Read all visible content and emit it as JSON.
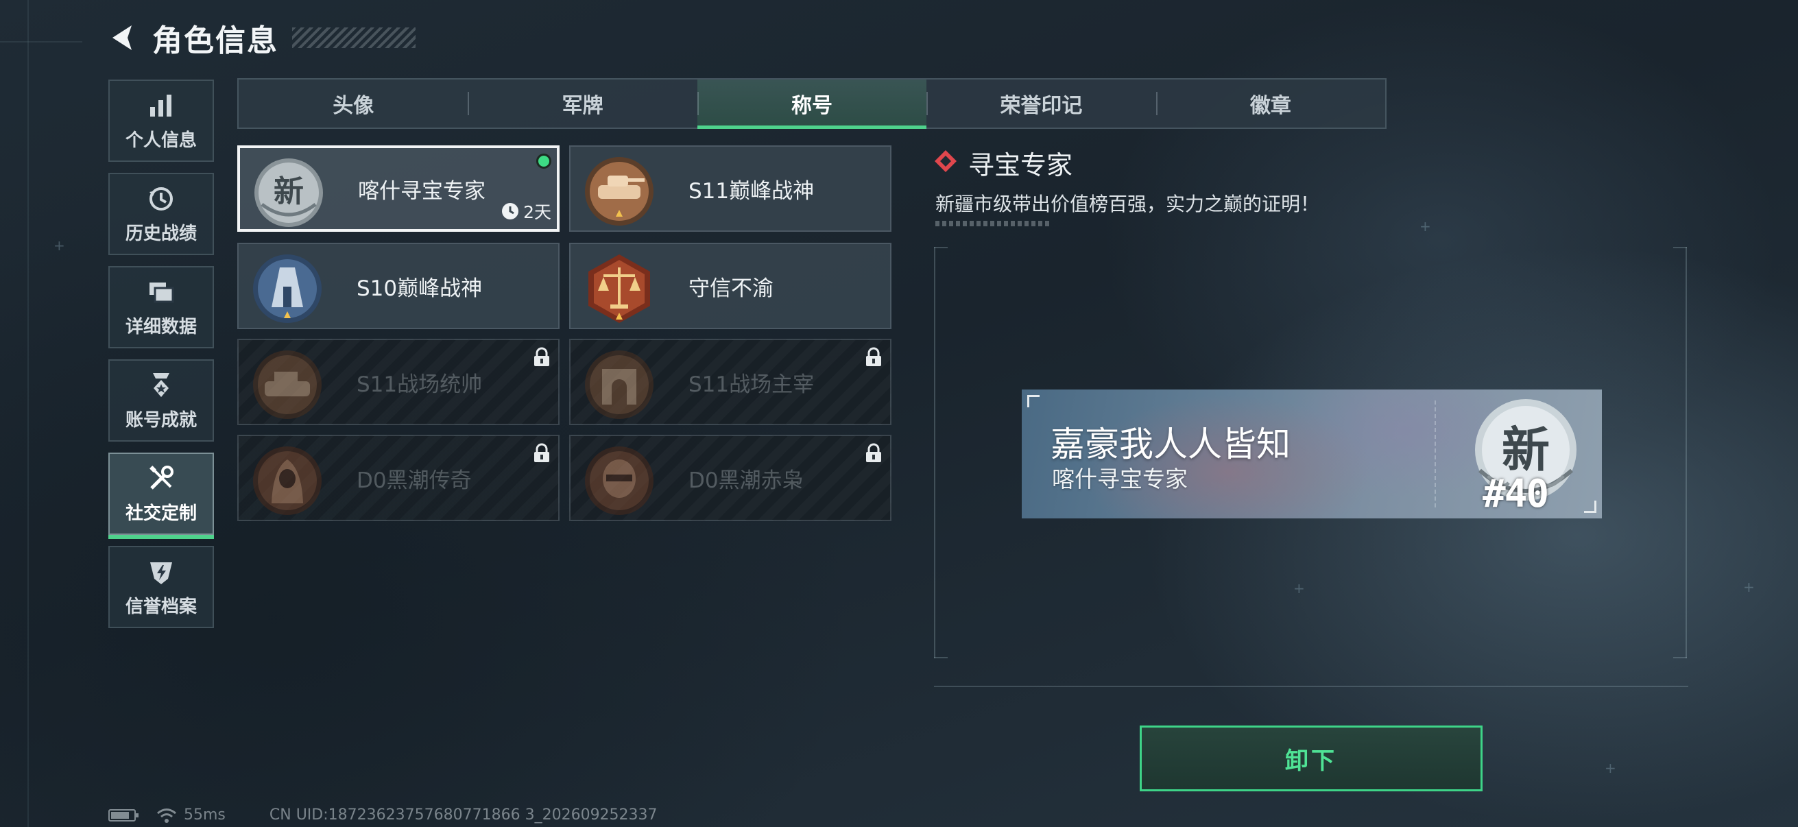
{
  "header": {
    "title": "角色信息"
  },
  "sidenav": [
    {
      "label": "个人信息",
      "icon": "bar-chart-icon",
      "active": false
    },
    {
      "label": "历史战绩",
      "icon": "history-clock-icon",
      "active": false
    },
    {
      "label": "详细数据",
      "icon": "folder-icon",
      "active": false
    },
    {
      "label": "账号成就",
      "icon": "achievement-medal-icon",
      "active": false
    },
    {
      "label": "社交定制",
      "icon": "tools-wrench-icon",
      "active": true
    },
    {
      "label": "信誉档案",
      "icon": "reputation-shield-icon",
      "active": false
    }
  ],
  "tabs": [
    {
      "label": "头像",
      "active": false
    },
    {
      "label": "军牌",
      "active": false
    },
    {
      "label": "称号",
      "active": true
    },
    {
      "label": "荣誉印记",
      "active": false
    },
    {
      "label": "徽章",
      "active": false
    }
  ],
  "titles": [
    {
      "label": "喀什寻宝专家",
      "emblem": "xin-emblem-icon",
      "state": "selected",
      "equipped": true,
      "timer": "2天"
    },
    {
      "label": "S11巅峰战神",
      "emblem": "tank-emblem-icon",
      "state": "unlocked"
    },
    {
      "label": "S10巅峰战神",
      "emblem": "tower-emblem-icon",
      "state": "unlocked"
    },
    {
      "label": "守信不渝",
      "emblem": "scales-emblem-icon",
      "state": "unlocked"
    },
    {
      "label": "S11战场统帅",
      "emblem": "vehicle-emblem-icon",
      "state": "locked"
    },
    {
      "label": "S11战场主宰",
      "emblem": "arch-emblem-icon",
      "state": "locked"
    },
    {
      "label": "D0黑潮传奇",
      "emblem": "hooded-figure-emblem-icon",
      "state": "locked"
    },
    {
      "label": "D0黑潮赤枭",
      "emblem": "masked-soldier-emblem-icon",
      "state": "locked"
    }
  ],
  "detail": {
    "title": "寻宝专家",
    "description": "新疆市级带出价值榜百强，实力之巅的证明！",
    "card_main": "嘉豪我人人皆知",
    "card_sub": "喀什寻宝专家",
    "card_badge_char": "新",
    "card_rank": "#40",
    "unequip_label": "卸下"
  },
  "status": {
    "ping": "55ms",
    "uid": "CN UID:18723623757680771866 3_202609252337"
  },
  "colors": {
    "accent": "#4fd28c",
    "equipped": "#3ddc84"
  }
}
